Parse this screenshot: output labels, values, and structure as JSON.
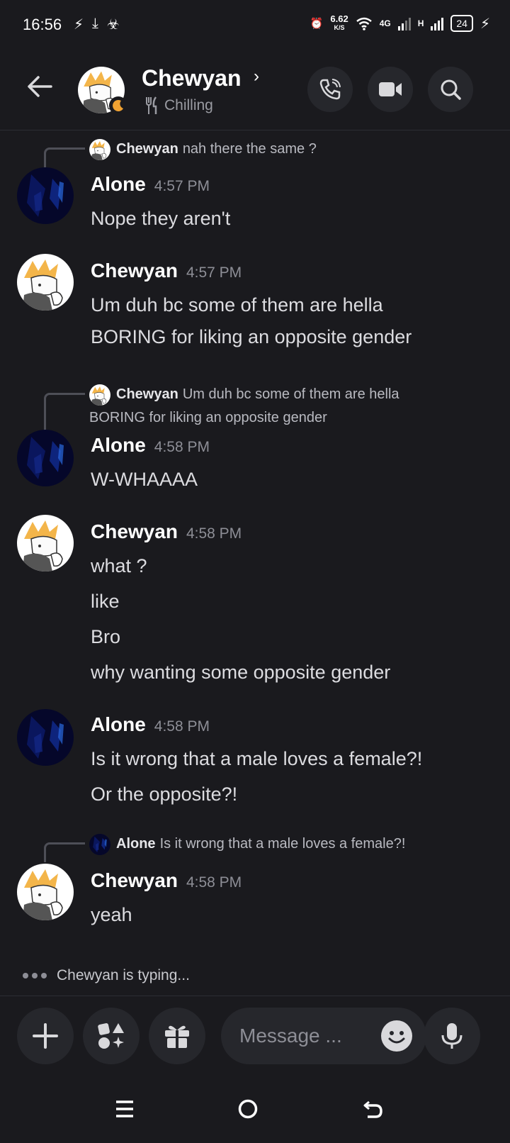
{
  "status_bar": {
    "time": "16:56",
    "speed": "6.62",
    "speed_unit": "K/S",
    "network_4g": "4G",
    "network_h": "H",
    "battery": "24"
  },
  "header": {
    "name": "Chewyan",
    "status": "Chilling"
  },
  "messages": [
    {
      "reply": {
        "author": "Chewyan",
        "text": "nah there the same ?",
        "avatar": "chewyan"
      },
      "author": "Alone",
      "time": "4:57 PM",
      "avatar": "alone",
      "lines": [
        "Nope they aren't"
      ]
    },
    {
      "author": "Chewyan",
      "time": "4:57 PM",
      "avatar": "chewyan",
      "lines": [
        "Um duh bc some of them are hella",
        "BORING for liking an opposite gender"
      ]
    },
    {
      "reply": {
        "author": "Chewyan",
        "text": "Um duh bc some of them are hella",
        "text2": "BORING for liking an opposite gender",
        "avatar": "chewyan"
      },
      "author": "Alone",
      "time": "4:58 PM",
      "avatar": "alone",
      "lines": [
        "W-WHAAAA"
      ]
    },
    {
      "author": "Chewyan",
      "time": "4:58 PM",
      "avatar": "chewyan",
      "lines": [
        "what ?",
        "like",
        "Bro",
        "why wanting some opposite gender"
      ]
    },
    {
      "author": "Alone",
      "time": "4:58 PM",
      "avatar": "alone",
      "lines": [
        "Is it wrong that a male loves a female?!",
        "Or the opposite?!"
      ]
    },
    {
      "reply": {
        "author": "Alone",
        "text": "Is it wrong that a male loves a female?!",
        "avatar": "alone"
      },
      "author": "Chewyan",
      "time": "4:58 PM",
      "avatar": "chewyan",
      "lines": [
        "yeah"
      ]
    }
  ],
  "typing": "Chewyan is typing...",
  "composer": {
    "placeholder": "Message ..."
  },
  "colors": {
    "background": "#1a1a1e",
    "button": "#26272c",
    "moon": "#f0a232"
  }
}
